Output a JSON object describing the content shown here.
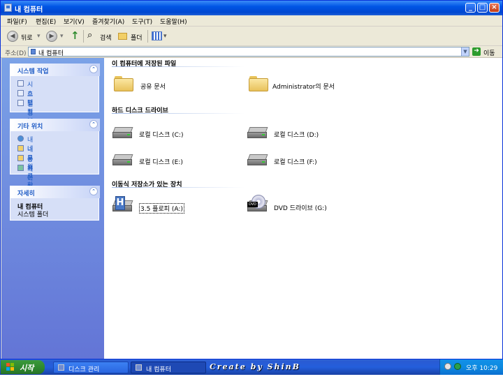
{
  "window": {
    "title": "내 컴퓨터",
    "minimize": "_",
    "maximize": "□",
    "close": "×"
  },
  "menu": [
    "파일(F)",
    "편집(E)",
    "보기(V)",
    "즐겨찾기(A)",
    "도구(T)",
    "도움말(H)"
  ],
  "toolbar": {
    "back": "뒤로",
    "search": "검색",
    "folders": "폴더"
  },
  "address": {
    "label": "주소(D)",
    "value": "내 컴퓨터",
    "go": "이동"
  },
  "left_panels": {
    "system_tasks": {
      "title": "시스템 작업",
      "items": [
        "시스템 정보 표시",
        "프로그램 추가/제거",
        "설정 변경"
      ]
    },
    "other_places": {
      "title": "기타 위치",
      "items": [
        "내 네트워크 환경",
        "내 문서",
        "공유 문서",
        "제어판"
      ]
    },
    "details": {
      "title": "자세히",
      "name": "내 컴퓨터",
      "type": "시스템 폴더"
    }
  },
  "groups": {
    "stored_files": {
      "title": "이 컴퓨터에 저장된 파일",
      "items": [
        "공유 문서",
        "Administrator의 문서"
      ]
    },
    "hard_drives": {
      "title": "하드 디스크 드라이브",
      "items": [
        "로컬 디스크 (C:)",
        "로컬 디스크 (D:)",
        "로컬 디스크 (E:)",
        "로컬 디스크 (F:)"
      ]
    },
    "removable": {
      "title": "이동식 저장소가 있는 장치",
      "items": [
        "3.5 플로피 (A:)",
        "DVD 드라이브 (G:)"
      ]
    }
  },
  "taskbar": {
    "start": "시작",
    "tasks": [
      "디스크 관리",
      "내 컴퓨터"
    ],
    "watermark": "Create by ShinB",
    "clock": "오후 10:29"
  },
  "colors": {
    "title_blue": "#0055e5",
    "left_panel": "#6375d6",
    "link": "#215dc6",
    "start_green": "#2f8a2f"
  }
}
